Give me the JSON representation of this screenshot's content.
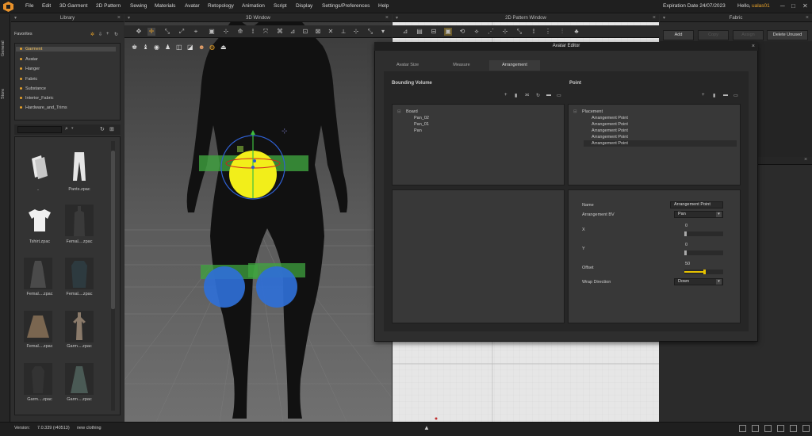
{
  "menu": [
    "File",
    "Edit",
    "3D Garment",
    "2D Pattern",
    "Sewing",
    "Materials",
    "Avatar",
    "Retopology",
    "Animation",
    "Script",
    "Display",
    "Settings/Preferences",
    "Help"
  ],
  "header": {
    "expiration": "Expiration Date 24/07/2023",
    "hello": "Hello,",
    "user": "ualas01"
  },
  "sidebar_tabs": [
    "General",
    "Store"
  ],
  "panels": {
    "library": "Library",
    "win3d": "3D Window",
    "win2d": "2D Pattern Window",
    "fabric": "Fabric"
  },
  "library": {
    "favorites_label": "Favorites",
    "items": [
      "Garment",
      "Avatar",
      "Hanger",
      "Fabric",
      "Substance",
      "Interior_Fabric",
      "Hardware_and_Trims"
    ],
    "thumbs": [
      "..",
      "Pants.zpac",
      "Tshirt.zpac",
      "Femal....zpac",
      "Femal....zpac",
      "Femal....zpac",
      "Femal....zpac",
      "Garm....zpac",
      "Garm....zpac",
      "Garm....zpac"
    ]
  },
  "fabric": {
    "add": "Add",
    "copy": "Copy",
    "assign": "Assign",
    "delete_unused": "Delete Unused"
  },
  "editor": {
    "title": "Avatar Editor",
    "tabs": [
      "Avatar Size",
      "Measure",
      "Arrangement"
    ],
    "bounding_volume": "Bounding Volume",
    "point": "Point",
    "bv_tree": [
      "Board",
      "Pan_02",
      "Pan_01",
      "Pan"
    ],
    "point_tree": [
      "Placement",
      "Arrangement Point",
      "Arrangement Point",
      "Arrangement Point",
      "Arrangement Point",
      "Arrangement Point"
    ],
    "props": {
      "name_label": "Name",
      "name_value": "Arrangement Point",
      "bv_label": "Arrangement BV",
      "bv_value": "Pan",
      "x_label": "X",
      "x_value": "0",
      "y_label": "Y",
      "y_value": "0",
      "offset_label": "Offset",
      "offset_value": "50",
      "wrap_label": "Wrap Direction",
      "wrap_value": "Down"
    },
    "offset_fraction": 0.5
  },
  "status": {
    "version_label": "Version:",
    "version": "7.0.339 (r40513)",
    "file": "new clothing"
  },
  "colors": {
    "accent": "#e8a22a",
    "highlight": "#e6c200",
    "blue_marker": "#2f6fd6",
    "green_marker": "#3fa33f"
  }
}
